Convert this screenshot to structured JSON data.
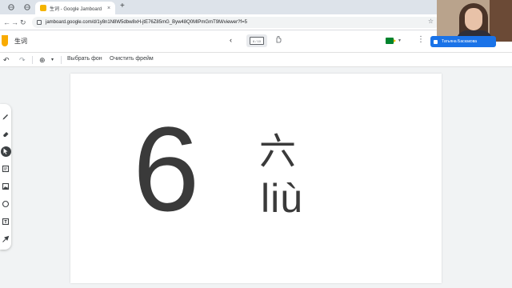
{
  "browser": {
    "tab": {
      "title": "生词 - Google Jamboard",
      "close": "×"
    },
    "new_tab": "+",
    "nav": {
      "back": "←",
      "forward": "→",
      "reload": "↻"
    },
    "url": "jamboard.google.com/d/1y8n1N8W5dbw8xH-jtE76Z85mG_Byw48Q0MlPmGmT9M/viewer?f=5",
    "star": "☆"
  },
  "appbar": {
    "title": "生词",
    "frame_indicator": "6 / 10",
    "prev": "‹",
    "share_label": "Татьяна Баскакова",
    "more": "⋮"
  },
  "toolrow": {
    "undo": "↶",
    "redo": "↷",
    "zoom": "⊕",
    "zoom_caret": "▾",
    "set_background": "Выбрать фон",
    "clear_frame": "Очистить фрейм"
  },
  "frame": {
    "digit": "6",
    "hanzi": "六",
    "pinyin": "liù"
  },
  "colors": {
    "accent": "#1a73e8",
    "jam_logo": "#f9ab00",
    "ink": "#3a3a3a"
  }
}
